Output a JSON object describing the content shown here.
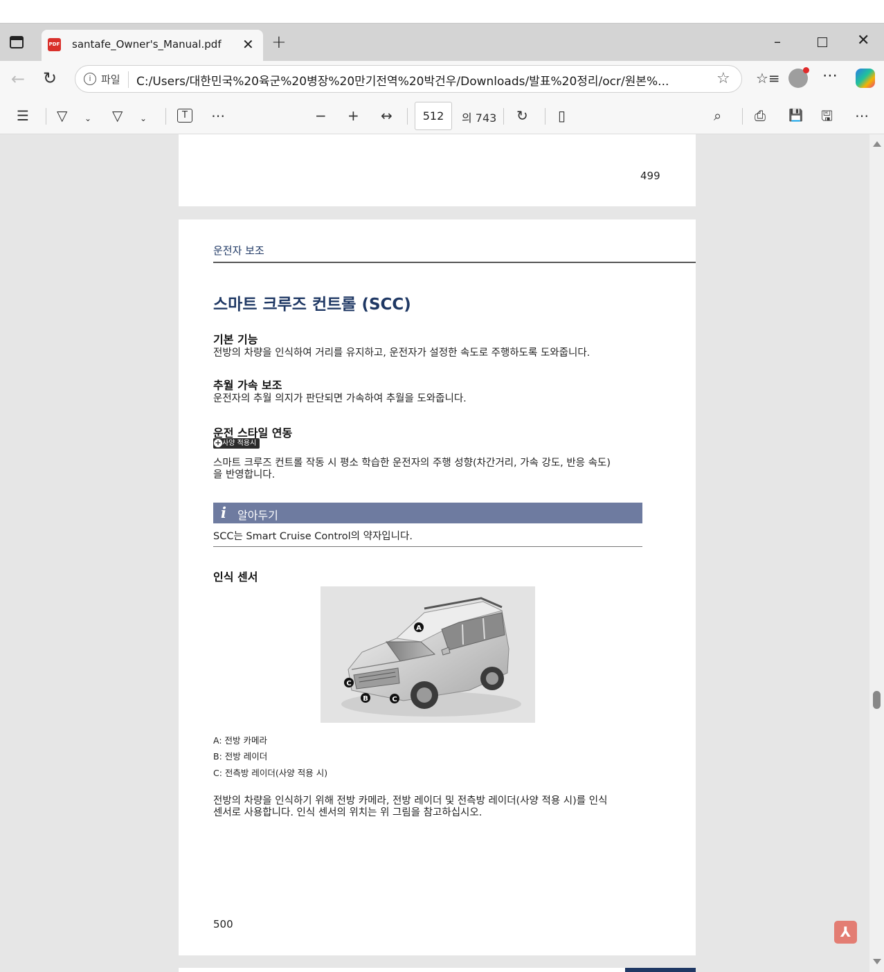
{
  "browser": {
    "tab": {
      "favicon": "PDF",
      "title": "santafe_Owner's_Manual.pdf"
    },
    "address": {
      "scheme_label": "파일",
      "url": "C:/Users/대한민국%20육군%20병장%20만기전역%20박건우/Downloads/발표%20정리/ocr/원본%..."
    },
    "icons": {
      "back": "←",
      "reload": "↻",
      "star": "☆",
      "favorites": "☆≡",
      "more": "⋯",
      "new_tab": "+",
      "close_tab": "✕",
      "minimize": "–",
      "close_window": "✕"
    }
  },
  "pdf_toolbar": {
    "current_page": "512",
    "total_pages": "의 743",
    "icons": {
      "contents": "☰",
      "highlight": "▽",
      "draw": "▽",
      "text_box": "T",
      "more": "⋯",
      "zoom_out": "−",
      "zoom_in": "+",
      "fit": "↔",
      "rotate": "↻",
      "page_view": "▯",
      "search": "⌕",
      "print": "⎙",
      "save": "💾",
      "save_as": "🖫"
    }
  },
  "document": {
    "previous_page_number": "499",
    "section_label": "운전자 보조",
    "title": "스마트 크루즈 컨트롤 (SCC)",
    "sections": [
      {
        "heading": "기본 기능",
        "text": "전방의 차량을 인식하여 거리를 유지하고, 운전자가 설정한 속도로 주행하도록 도와줍니다."
      },
      {
        "heading": "추월 가속 보조",
        "text": "운전자의 추월 의지가 판단되면 가속하여 추월을 도와줍니다."
      },
      {
        "heading": "운전 스타일 연동",
        "badge": "사양 적용시",
        "text_lines": [
          "스마트 크루즈 컨트롤 작동 시 평소 학습한 운전자의 주행 성향(차간거리, 가속 강도, 반응 속도)",
          "을 반영합니다."
        ]
      }
    ],
    "note": {
      "icon": "i",
      "title": "알아두기",
      "text": "SCC는 Smart Cruise Control의 약자입니다."
    },
    "sensor_heading": "인식 센서",
    "figure_markers": [
      "A",
      "B",
      "C",
      "C"
    ],
    "captions": [
      "A: 전방 카메라",
      "B: 전방 레이더",
      "C: 전측방 레이더(사양 적용 시)"
    ],
    "final_text_lines": [
      "전방의 차량을 인식하기 위해 전방 카메라, 전방 레이더 및 전측방 레이더(사양 적용 시)를 인식",
      "센서로 사용합니다. 인식 센서의 위치는 위 그림을 참고하십시오."
    ],
    "page_number": "500"
  }
}
